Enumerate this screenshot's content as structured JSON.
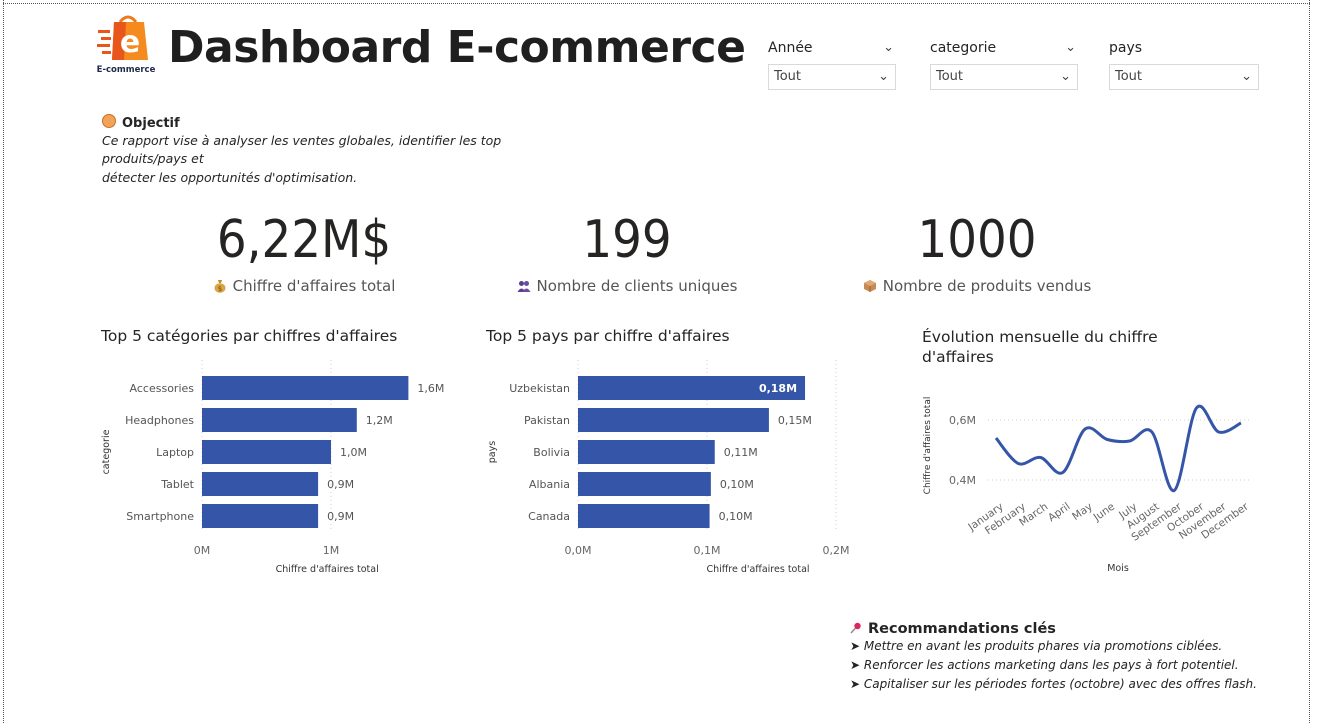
{
  "header": {
    "title": "Dashboard E-commerce",
    "logo_text": "E-commerce"
  },
  "filters": [
    {
      "label": "Année",
      "value": "Tout"
    },
    {
      "label": "categorie",
      "value": "Tout"
    },
    {
      "label": "pays",
      "value": "Tout"
    }
  ],
  "objective": {
    "title": "Objectif",
    "text_line1": "Ce rapport vise à analyser les ventes globales, identifier les top produits/pays et",
    "text_line2": "détecter les opportunités d'optimisation."
  },
  "kpis": [
    {
      "value": "6,22M$",
      "label": "Chiffre d'affaires total",
      "icon": "money-bag-icon"
    },
    {
      "value": "199",
      "label": "Nombre de clients uniques",
      "icon": "users-icon"
    },
    {
      "value": "1000",
      "label": "Nombre de produits vendus",
      "icon": "package-icon"
    }
  ],
  "colors": {
    "bar": "#3556a8",
    "line": "#3556a8"
  },
  "chart_data": [
    {
      "type": "bar",
      "title": "Top 5 catégories par chiffres d'affaires",
      "xlabel": "Chiffre d'affaires total",
      "ylabel": "categorie",
      "categories": [
        "Accessories",
        "Headphones",
        "Laptop",
        "Tablet",
        "Smartphone"
      ],
      "values": [
        1.6,
        1.2,
        1.0,
        0.9,
        0.9
      ],
      "data_labels": [
        "1,6M",
        "1,2M",
        "1,0M",
        "0,9M",
        "0,9M"
      ],
      "x_ticks": [
        "0M",
        "1M"
      ],
      "xlim": [
        0,
        1.6
      ],
      "orientation": "horizontal"
    },
    {
      "type": "bar",
      "title": "Top 5 pays par chiffre d'affaires",
      "xlabel": "Chiffre d'affaires total",
      "ylabel": "pays",
      "categories": [
        "Uzbekistan",
        "Pakistan",
        "Bolivia",
        "Albania",
        "Canada"
      ],
      "values": [
        0.176,
        0.148,
        0.106,
        0.103,
        0.102
      ],
      "data_labels": [
        "0,18M",
        "0,15M",
        "0,11M",
        "0,10M",
        "0,10M"
      ],
      "x_ticks": [
        "0,0M",
        "0,1M",
        "0,2M"
      ],
      "xlim": [
        0,
        0.2
      ],
      "orientation": "horizontal"
    },
    {
      "type": "line",
      "title_line1": "Évolution mensuelle du chiffre",
      "title_line2": "d'affaires",
      "xlabel": "Mois",
      "ylabel": "Chiffre d'affaires total",
      "x": [
        "January",
        "February",
        "March",
        "April",
        "May",
        "June",
        "July",
        "August",
        "September",
        "October",
        "November",
        "December"
      ],
      "values": [
        0.54,
        0.455,
        0.475,
        0.425,
        0.57,
        0.535,
        0.53,
        0.56,
        0.365,
        0.64,
        0.56,
        0.59
      ],
      "y_ticks": [
        "0,4M",
        "0,6M"
      ],
      "ylim": [
        0.35,
        0.68
      ]
    }
  ],
  "recommendations": {
    "title": "Recommandations clés",
    "items": [
      "➤ Mettre en avant les produits phares via promotions ciblées.",
      "➤ Renforcer les actions marketing dans les pays à fort potentiel.",
      "➤ Capitaliser sur les périodes fortes (octobre) avec des offres flash."
    ]
  }
}
